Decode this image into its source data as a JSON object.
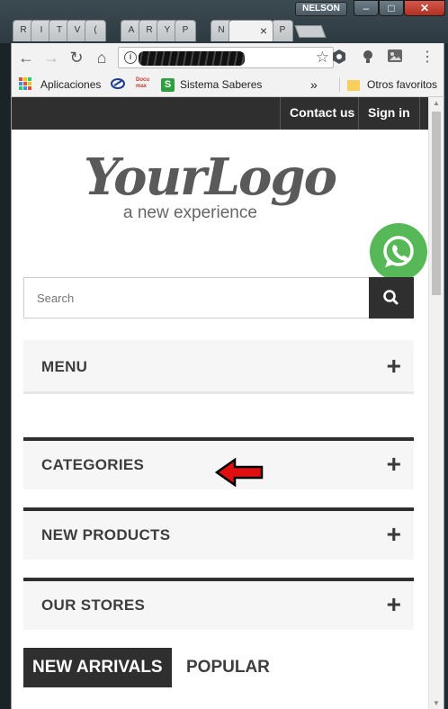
{
  "window": {
    "user_badge": "NELSON",
    "minimize": "–",
    "maximize": "□",
    "close": "✕"
  },
  "tabs": [
    {
      "label": "R"
    },
    {
      "label": "I"
    },
    {
      "label": "T"
    },
    {
      "label": "V"
    },
    {
      "label": "("
    },
    {
      "label": "A"
    },
    {
      "label": "R"
    },
    {
      "label": "Y"
    },
    {
      "label": "P"
    },
    {
      "label": "N"
    },
    {
      "label": "",
      "active": true
    },
    {
      "label": "P"
    }
  ],
  "toolbar": {
    "back_icon": "←",
    "forward_icon": "→",
    "reload_icon": "↻",
    "home_icon": "⌂",
    "info_icon": "i",
    "url": "",
    "star_icon": "☆",
    "extensions": [
      "eye-icon",
      "lightbulb-icon",
      "photo-icon"
    ],
    "menu_icon": "⋮"
  },
  "bookmarks": {
    "apps": "Aplicaciones",
    "item2": "",
    "item3": "Docu max",
    "sistema": "Sistema Saberes",
    "s_badge": "S",
    "overflow": "»",
    "other": "Otros favoritos"
  },
  "page": {
    "contact": "Contact us",
    "signin": "Sign in",
    "logo_main": "YourLogo",
    "logo_sub": "a new experience",
    "search_placeholder": "Search",
    "panels": [
      {
        "label": "MENU",
        "plus": "+"
      },
      {
        "label": "CATEGORIES",
        "plus": "+"
      },
      {
        "label": "NEW PRODUCTS",
        "plus": "+"
      },
      {
        "label": "OUR STORES",
        "plus": "+"
      }
    ],
    "tab_new": "NEW ARRIVALS",
    "tab_popular": "POPULAR"
  },
  "colors": {
    "dark": "#2f2f2f",
    "whatsapp": "#57b857",
    "arrow": "#e01010",
    "panel_bg": "#f6f6f6"
  }
}
